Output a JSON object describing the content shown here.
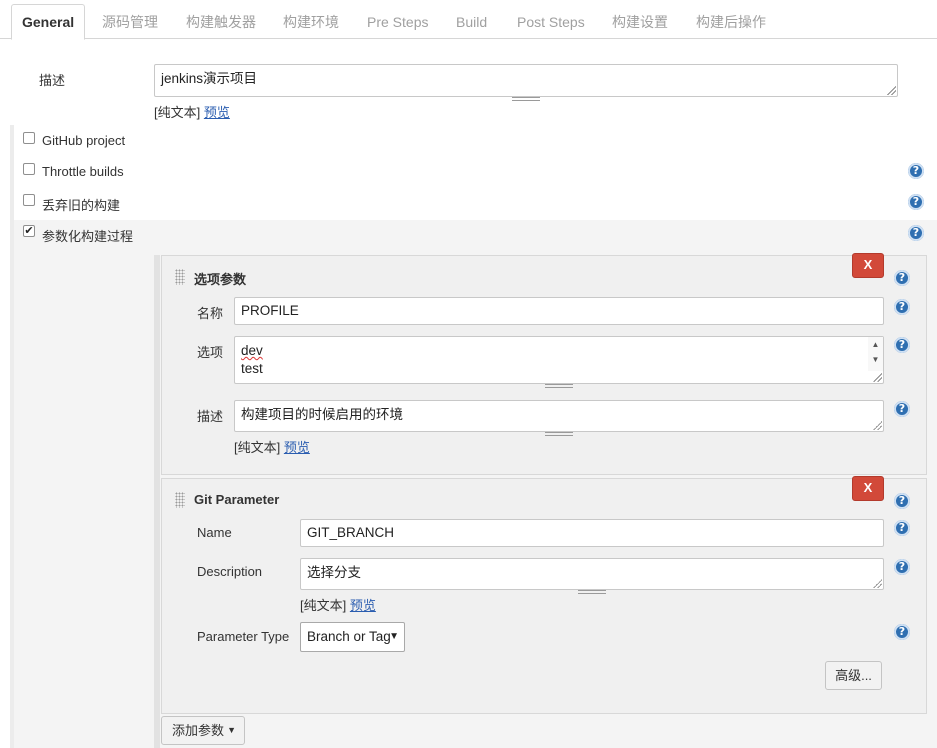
{
  "tabs": [
    "General",
    "源码管理",
    "构建触发器",
    "构建环境",
    "Pre Steps",
    "Build",
    "Post Steps",
    "构建设置",
    "构建后操作"
  ],
  "description": {
    "label": "描述",
    "value": "jenkins演示项目",
    "plain_text": "[纯文本]",
    "preview": "预览"
  },
  "options": [
    {
      "label": "GitHub project",
      "checked": false
    },
    {
      "label": "Throttle builds",
      "checked": false
    },
    {
      "label": "丢弃旧的构建",
      "checked": false
    },
    {
      "label": "参数化构建过程",
      "checked": true
    }
  ],
  "choice_param": {
    "title": "选项参数",
    "delete_label": "X",
    "name_label": "名称",
    "name_value": "PROFILE",
    "choices_label": "选项",
    "choices": [
      "dev",
      "test"
    ],
    "desc_label": "描述",
    "desc_value": "构建项目的时候启用的环境",
    "plain_text": "[纯文本]",
    "preview": "预览"
  },
  "git_param": {
    "title": "Git Parameter",
    "delete_label": "X",
    "name_label": "Name",
    "name_value": "GIT_BRANCH",
    "desc_label": "Description",
    "desc_value": "选择分支",
    "plain_text": "[纯文本]",
    "preview": "预览",
    "type_label": "Parameter Type",
    "type_value": "Branch or Tag",
    "advanced_label": "高级..."
  },
  "add_param_label": "添加参数",
  "help_glyph": "?",
  "colors": {
    "link": "#2a5db0",
    "delete": "#d24939",
    "help": "#2f6fb1"
  }
}
